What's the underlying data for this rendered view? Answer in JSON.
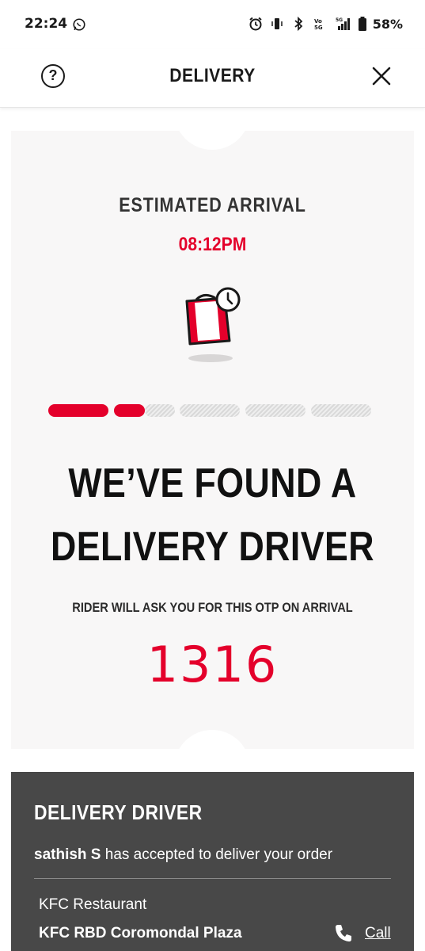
{
  "status_bar": {
    "time": "22:24",
    "battery": "58%",
    "network": "5G",
    "volte": "Vo 5G"
  },
  "header": {
    "title": "DELIVERY",
    "help_symbol": "?",
    "left_icon": "help-circle-icon",
    "right_icon": "close-icon"
  },
  "tracking": {
    "eta_label": "ESTIMATED ARRIVAL",
    "eta_time": "08:12PM",
    "progress": {
      "completed_steps": 2,
      "total_steps": 6
    },
    "headline_line1": "WE’VE FOUND A",
    "headline_line2": "DELIVERY DRIVER",
    "otp_label": "RIDER WILL ASK YOU FOR THIS OTP ON ARRIVAL",
    "otp": "1316"
  },
  "driver": {
    "section_title": "DELIVERY DRIVER",
    "name": "sathish S",
    "message": " has accepted to deliver your order",
    "restaurant_label": "KFC Restaurant",
    "restaurant_name": "KFC RBD Coromondal Plaza",
    "call_label": "Call"
  },
  "colors": {
    "accent": "#e4002b",
    "card_bg": "#f8f7f7",
    "panel_bg": "#484848"
  }
}
